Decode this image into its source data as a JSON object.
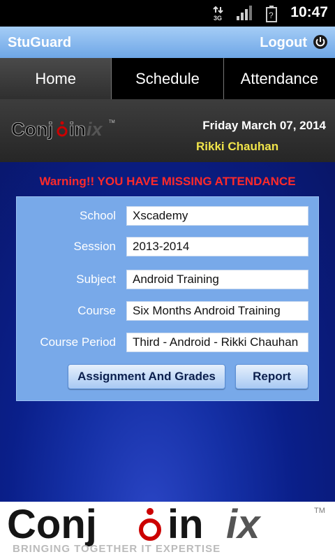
{
  "status_bar": {
    "time": "10:47",
    "network": "3G",
    "icons": [
      "data-transfer-icon",
      "signal-icon",
      "battery-unknown-icon"
    ]
  },
  "title_bar": {
    "app_name": "StuGuard",
    "logout_label": "Logout",
    "power_icon": "power-icon"
  },
  "nav": {
    "tabs": [
      {
        "label": "Home",
        "active": true
      },
      {
        "label": "Schedule",
        "active": false
      },
      {
        "label": "Attendance",
        "active": false
      }
    ]
  },
  "header": {
    "logo_text": "Conjoinix",
    "date": "Friday March 07, 2014",
    "user": "Rikki Chauhan"
  },
  "warning": "Warning!! YOU HAVE MISSING ATTENDANCE",
  "form": {
    "fields": [
      {
        "label": "School",
        "value": "Xscademy"
      },
      {
        "label": "Session",
        "value": "2013-2014"
      },
      {
        "label": "Subject",
        "value": "Android Training"
      },
      {
        "label": "Course",
        "value": "Six Months Android Training"
      },
      {
        "label": "Course Period",
        "value": "Third - Android - Rikki  Chauhan"
      }
    ],
    "assignment_button": "Assignment And Grades",
    "report_button": "Report"
  },
  "footer": {
    "logo_text": "Conjoinix",
    "tagline": "BRINGING TOGETHER IT EXPERTISE"
  },
  "colors": {
    "title_bar": "#8ebcf0",
    "warning": "#ff2a2a",
    "user_name": "#f0e44a",
    "panel": "#78a9e9",
    "main_background": "#0a1f8a"
  }
}
